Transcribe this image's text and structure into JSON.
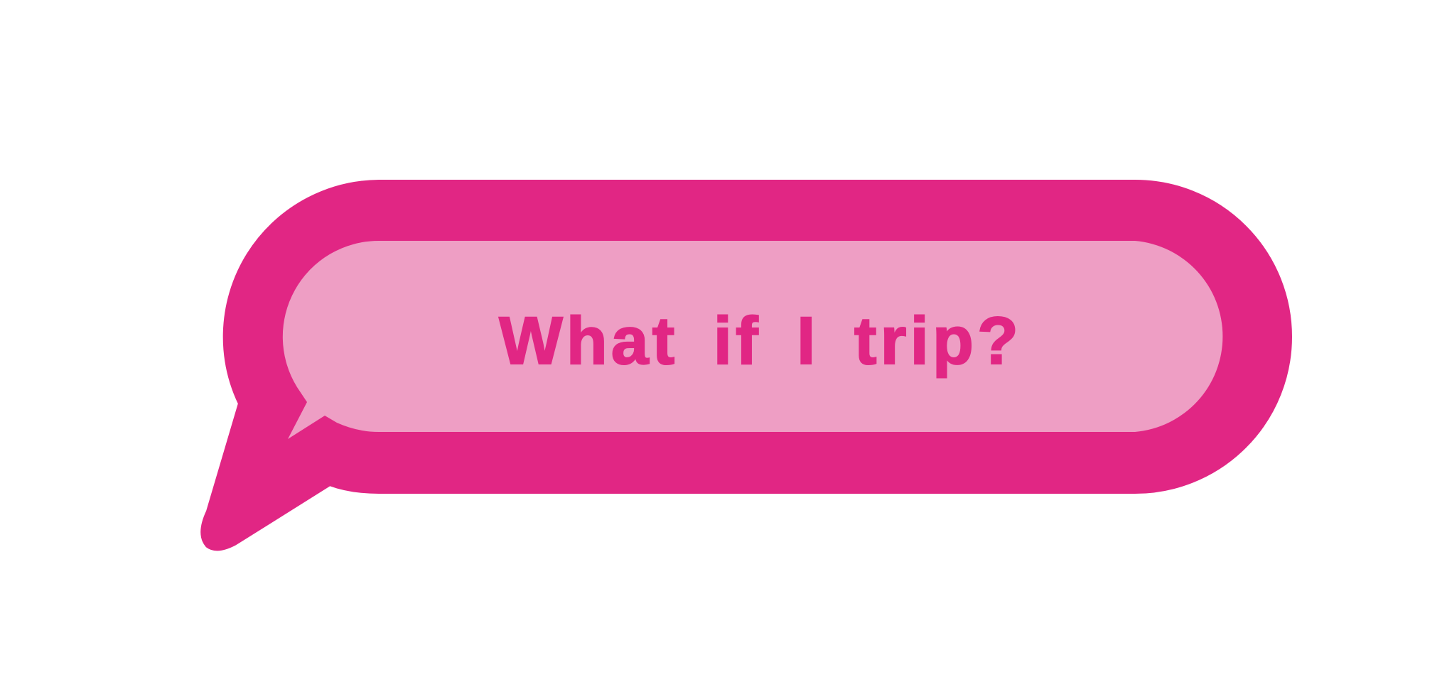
{
  "speech_bubble": {
    "text": "What if I trip?",
    "colors": {
      "outline": "#e12684",
      "fill": "#ee9ec4",
      "text": "#e12684",
      "background": "#ffffff"
    }
  }
}
